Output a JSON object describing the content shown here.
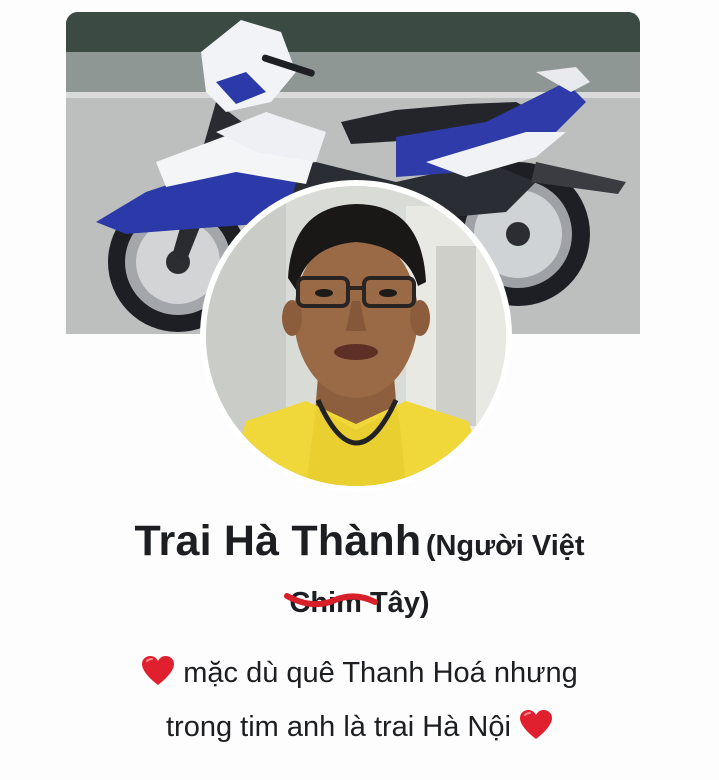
{
  "profile": {
    "name": "Trai Hà Thành",
    "name_note_prefix": "(Người Việt",
    "struck_word": "Chim",
    "name_note_suffix": "Tây)",
    "bio_line1": "mặc dù quê Thanh Hoá nhưng",
    "bio_line2": "trong tim anh là trai Hà Nội"
  },
  "icons": {
    "bio_heart_start": "red-heart-icon",
    "bio_heart_end": "red-heart-icon"
  },
  "colors": {
    "heart": "#e0202f",
    "strike": "#d8202a",
    "text": "#1c1e21"
  }
}
